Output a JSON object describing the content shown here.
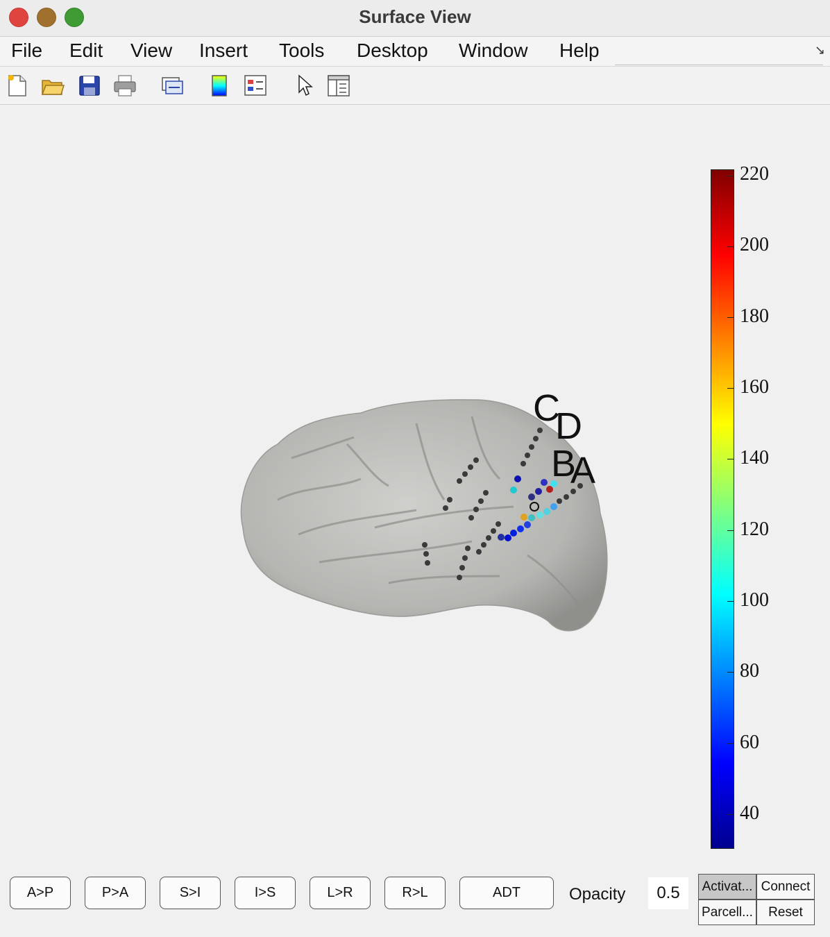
{
  "window": {
    "title": "Surface View"
  },
  "menu": [
    "File",
    "Edit",
    "View",
    "Insert",
    "Tools",
    "Desktop",
    "Window",
    "Help"
  ],
  "toolbar_icons": [
    "new-figure-icon",
    "open-file-icon",
    "save-icon",
    "print-icon",
    "link-icon",
    "colorbar-icon",
    "legend-icon",
    "pointer-icon",
    "property-inspector-icon"
  ],
  "colorbar": {
    "colormap": "jet",
    "ticks": [
      "220",
      "200",
      "180",
      "160",
      "140",
      "120",
      "100",
      "80",
      "60",
      "40"
    ]
  },
  "electrodes": {
    "labels": [
      "C",
      "D",
      "B",
      "A"
    ]
  },
  "controls": {
    "view_buttons": [
      "A>P",
      "P>A",
      "S>I",
      "I>S",
      "L>R",
      "R>L",
      "ADT"
    ],
    "opacity_label": "Opacity",
    "opacity_value": "0.5",
    "mode_buttons": [
      "Activat...",
      "Connect",
      "Parcell...",
      "Reset"
    ]
  },
  "colors": {
    "surface": "#bcbcba",
    "background": "#f0f0f0",
    "electrode_inactive": "#3a3a3a"
  }
}
